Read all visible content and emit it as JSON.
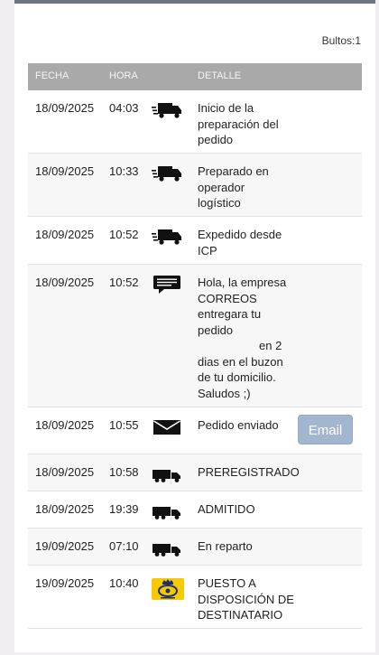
{
  "header": {
    "bultos": "Bultos:1"
  },
  "columns": {
    "fecha": "FECHA",
    "hora": "HORA",
    "detalle": "DETALLE"
  },
  "rows": [
    {
      "date": "18/09/2025",
      "time": "04:03",
      "icon": "delivery-truck-icon",
      "detail": [
        "Inicio de la",
        "preparación del",
        "pedido"
      ]
    },
    {
      "date": "18/09/2025",
      "time": "10:33",
      "icon": "delivery-truck-icon",
      "detail": [
        "Preparado en",
        "operador",
        "logístico"
      ]
    },
    {
      "date": "18/09/2025",
      "time": "10:52",
      "icon": "delivery-truck-icon",
      "detail": [
        "Expedido desde",
        "ICP"
      ]
    },
    {
      "date": "18/09/2025",
      "time": "10:52",
      "icon": "message-bubble-icon",
      "detail": [
        "Hola, la empresa",
        "CORREOS",
        "entregara tu",
        "pedido",
        "en 2",
        "dias en el buzon",
        "de tu domicilio.",
        "Saludos ;)"
      ]
    },
    {
      "date": "18/09/2025",
      "time": "10:55",
      "icon": "envelope-icon",
      "detail": [
        "Pedido enviado"
      ],
      "button": "Email"
    },
    {
      "date": "18/09/2025",
      "time": "10:58",
      "icon": "lorry-icon",
      "detail": [
        "PREREGISTRADO"
      ]
    },
    {
      "date": "18/09/2025",
      "time": "19:39",
      "icon": "lorry-icon",
      "detail": [
        "ADMITIDO"
      ]
    },
    {
      "date": "19/09/2025",
      "time": "07:10",
      "icon": "lorry-icon",
      "detail": [
        "En reparto"
      ]
    },
    {
      "date": "19/09/2025",
      "time": "10:40",
      "icon": "correos-logo-icon",
      "detail": [
        "PUESTO A",
        "DISPOSICIÓN DE",
        "DESTINATARIO"
      ]
    }
  ],
  "colors": {
    "header_bg": "#a9a9a9",
    "email_button": "#a3b6cf",
    "correos_yellow": "#f6c900",
    "top_bar": "#6d7583"
  }
}
